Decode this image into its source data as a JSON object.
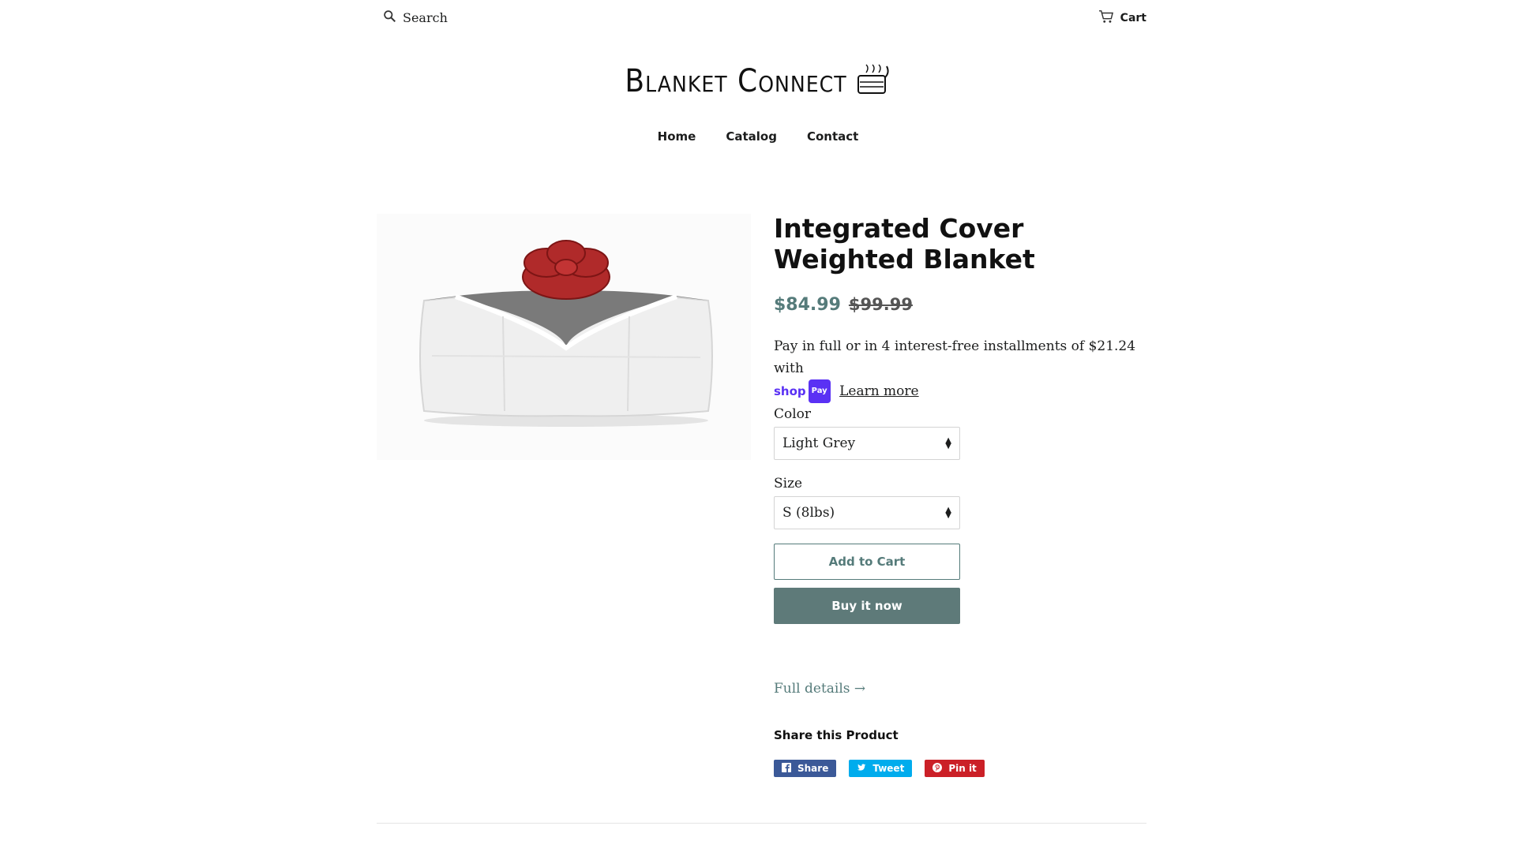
{
  "header": {
    "search_label": "Search",
    "cart_label": "Cart",
    "logo_text": "Blanket Connect"
  },
  "nav": {
    "items": [
      {
        "label": "Home"
      },
      {
        "label": "Catalog"
      },
      {
        "label": "Contact"
      }
    ]
  },
  "product": {
    "title": "Integrated Cover Weighted Blanket",
    "price": "$84.99",
    "compare_price": "$99.99",
    "installments_text": "Pay in full or in 4 interest-free installments of $21.24 with",
    "shoppay_shop": "shop",
    "shoppay_pay": "Pay",
    "learn_more": "Learn more",
    "color_label": "Color",
    "color_value": "Light Grey",
    "size_label": "Size",
    "size_value": "S (8lbs)",
    "add_to_cart": "Add to Cart",
    "buy_now": "Buy it now",
    "full_details": "Full details →",
    "share_title": "Share this Product",
    "share_buttons": [
      {
        "label": "Share",
        "network": "facebook",
        "color": "#3b5998"
      },
      {
        "label": "Tweet",
        "network": "twitter",
        "color": "#00aced"
      },
      {
        "label": "Pin it",
        "network": "pinterest",
        "color": "#cb2027"
      }
    ]
  },
  "colors": {
    "accent": "#557b7a",
    "buy_button": "#5e7a79",
    "shoppay": "#5a31f4"
  }
}
